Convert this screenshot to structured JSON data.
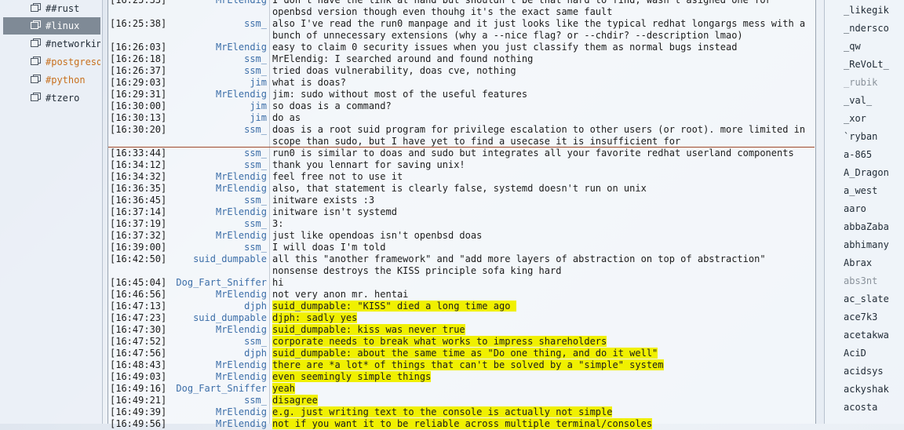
{
  "channels": [
    {
      "label": "##rust",
      "state": "normal"
    },
    {
      "label": "#linux",
      "state": "active"
    },
    {
      "label": "#networking",
      "state": "normal"
    },
    {
      "label": "#postgresql",
      "state": "hl"
    },
    {
      "label": "#python",
      "state": "hl"
    },
    {
      "label": "#tzero",
      "state": "normal"
    }
  ],
  "messages": [
    {
      "ts": "[16:25:33]",
      "nick": "MrElendig",
      "text": "I don't have the link at hand but shouldn't be that hard to find, wasn't asigned one for",
      "hl": false
    },
    {
      "ts": "",
      "nick": "",
      "text": "openbsd version though even thouhg it's the exact same fault",
      "hl": false
    },
    {
      "ts": "[16:25:38]",
      "nick": "ssm_",
      "text": "also I've read the run0 manpage and it just looks like the typical redhat longargs mess with a",
      "hl": false
    },
    {
      "ts": "",
      "nick": "",
      "text": "bunch of unnecessary extensions (why a --nice flag? or --chdir? --description lmao)",
      "hl": false
    },
    {
      "ts": "[16:26:03]",
      "nick": "MrElendig",
      "text": "easy to claim 0 security issues when you just classify them as normal bugs instead",
      "hl": false
    },
    {
      "ts": "[16:26:18]",
      "nick": "ssm_",
      "text": "MrElendig: I searched around and found nothing",
      "hl": false
    },
    {
      "ts": "[16:26:37]",
      "nick": "ssm_",
      "text": "tried doas vulnerability, doas cve, nothing",
      "hl": false
    },
    {
      "ts": "[16:29:03]",
      "nick": "jim",
      "text": "what is doas?",
      "hl": false
    },
    {
      "ts": "[16:29:31]",
      "nick": "MrElendig",
      "text": "jim: sudo without most of the useful features",
      "hl": false
    },
    {
      "ts": "[16:30:00]",
      "nick": "jim",
      "text": "so doas is a command?",
      "hl": false
    },
    {
      "ts": "[16:30:13]",
      "nick": "jim",
      "text": "do as",
      "hl": false
    },
    {
      "ts": "[16:30:20]",
      "nick": "ssm_",
      "text": "doas is a root suid program for privilege escalation to other users (or root). more limited in",
      "hl": false
    },
    {
      "ts": "",
      "nick": "",
      "text": "scope than sudo, but I have yet to find a usecase it is insufficient for",
      "hl": false
    },
    {
      "ts": "[16:33:44]",
      "nick": "ssm_",
      "text": "run0 is similar to doas and sudo but integrates all your favorite redhat userland components",
      "hl": false
    },
    {
      "ts": "[16:34:12]",
      "nick": "ssm_",
      "text": "thank you lennart for saving unix!",
      "hl": false
    },
    {
      "ts": "[16:34:32]",
      "nick": "MrElendig",
      "text": "feel free not to use it",
      "hl": false
    },
    {
      "ts": "[16:36:35]",
      "nick": "MrElendig",
      "text": "also, that statement is clearly false, systemd doesn't run on unix",
      "hl": false
    },
    {
      "ts": "[16:36:45]",
      "nick": "ssm_",
      "text": "initware exists :3",
      "hl": false
    },
    {
      "ts": "[16:37:14]",
      "nick": "MrElendig",
      "text": "initware isn't systemd",
      "hl": false
    },
    {
      "ts": "[16:37:19]",
      "nick": "ssm_",
      "text": "3:",
      "hl": false
    },
    {
      "ts": "[16:37:32]",
      "nick": "MrElendig",
      "text": "just like opendoas isn't openbsd doas",
      "hl": false
    },
    {
      "ts": "[16:39:00]",
      "nick": "ssm_",
      "text": "I will doas I'm told",
      "hl": false
    },
    {
      "ts": "[16:42:50]",
      "nick": "suid_dumpable",
      "text": "all this \"another framework\" and \"add more layers of abstraction on top of abstraction\"",
      "hl": false
    },
    {
      "ts": "",
      "nick": "",
      "text": "nonsense destroys the KISS principle sofa king hard",
      "hl": false
    },
    {
      "ts": "[16:45:04]",
      "nick": "Dog_Fart_Sniffer",
      "text": "hi",
      "hl": false
    },
    {
      "ts": "[16:46:56]",
      "nick": "MrElendig",
      "text": "not very anon mr. hentai",
      "hl": false
    },
    {
      "ts": "[16:47:13]",
      "nick": "djph",
      "text": "suid_dumpable: \"KISS\" died a long time ago ",
      "hl": true
    },
    {
      "ts": "[16:47:23]",
      "nick": "suid_dumpable",
      "text": "djph: sadly yes",
      "hl": true
    },
    {
      "ts": "[16:47:30]",
      "nick": "MrElendig",
      "text": "suid_dumpable: kiss was never true",
      "hl": true
    },
    {
      "ts": "[16:47:52]",
      "nick": "ssm_",
      "text": "corporate needs to break what works to impress shareholders",
      "hl": true
    },
    {
      "ts": "[16:47:56]",
      "nick": "djph",
      "text": "suid_dumpable: about the same time as \"Do one thing, and do it well\"",
      "hl": true
    },
    {
      "ts": "[16:48:43]",
      "nick": "MrElendig",
      "text": "there are *a lot* of things that can't be solved by a \"simple\" system",
      "hl": true
    },
    {
      "ts": "[16:49:03]",
      "nick": "MrElendig",
      "text": "even seemingly simple things",
      "hl": true
    },
    {
      "ts": "[16:49:16]",
      "nick": "Dog_Fart_Sniffer",
      "text": "yeah",
      "hl": true
    },
    {
      "ts": "[16:49:21]",
      "nick": "ssm_",
      "text": "disagree",
      "hl": true
    },
    {
      "ts": "[16:49:39]",
      "nick": "MrElendig",
      "text": "e.g. just writing text to the console is actually not simple",
      "hl": true
    },
    {
      "ts": "[16:49:56]",
      "nick": "MrElendig",
      "text": "not if you want it to be reliable across multiple terminal/consoles",
      "hl": true
    }
  ],
  "nicks": [
    {
      "name": "_likegik",
      "away": false
    },
    {
      "name": "_ndersco",
      "away": false
    },
    {
      "name": "_qw",
      "away": false
    },
    {
      "name": "_ReVoLt_",
      "away": false
    },
    {
      "name": "_rubik",
      "away": true
    },
    {
      "name": "_val_",
      "away": false
    },
    {
      "name": "_xor",
      "away": false
    },
    {
      "name": "`ryban",
      "away": false
    },
    {
      "name": "a-865",
      "away": false
    },
    {
      "name": "A_Dragon",
      "away": false
    },
    {
      "name": "a_west",
      "away": false
    },
    {
      "name": "aaro",
      "away": false
    },
    {
      "name": "abbaZaba",
      "away": false
    },
    {
      "name": "abhimany",
      "away": false
    },
    {
      "name": "Abrax",
      "away": false
    },
    {
      "name": "abs3nt",
      "away": true
    },
    {
      "name": "ac_slate",
      "away": false
    },
    {
      "name": "ace7k3",
      "away": false
    },
    {
      "name": "acetakwa",
      "away": false
    },
    {
      "name": "AciD",
      "away": false
    },
    {
      "name": "acidsys",
      "away": false
    },
    {
      "name": "ackyshak",
      "away": false
    },
    {
      "name": "acosta",
      "away": false
    }
  ]
}
